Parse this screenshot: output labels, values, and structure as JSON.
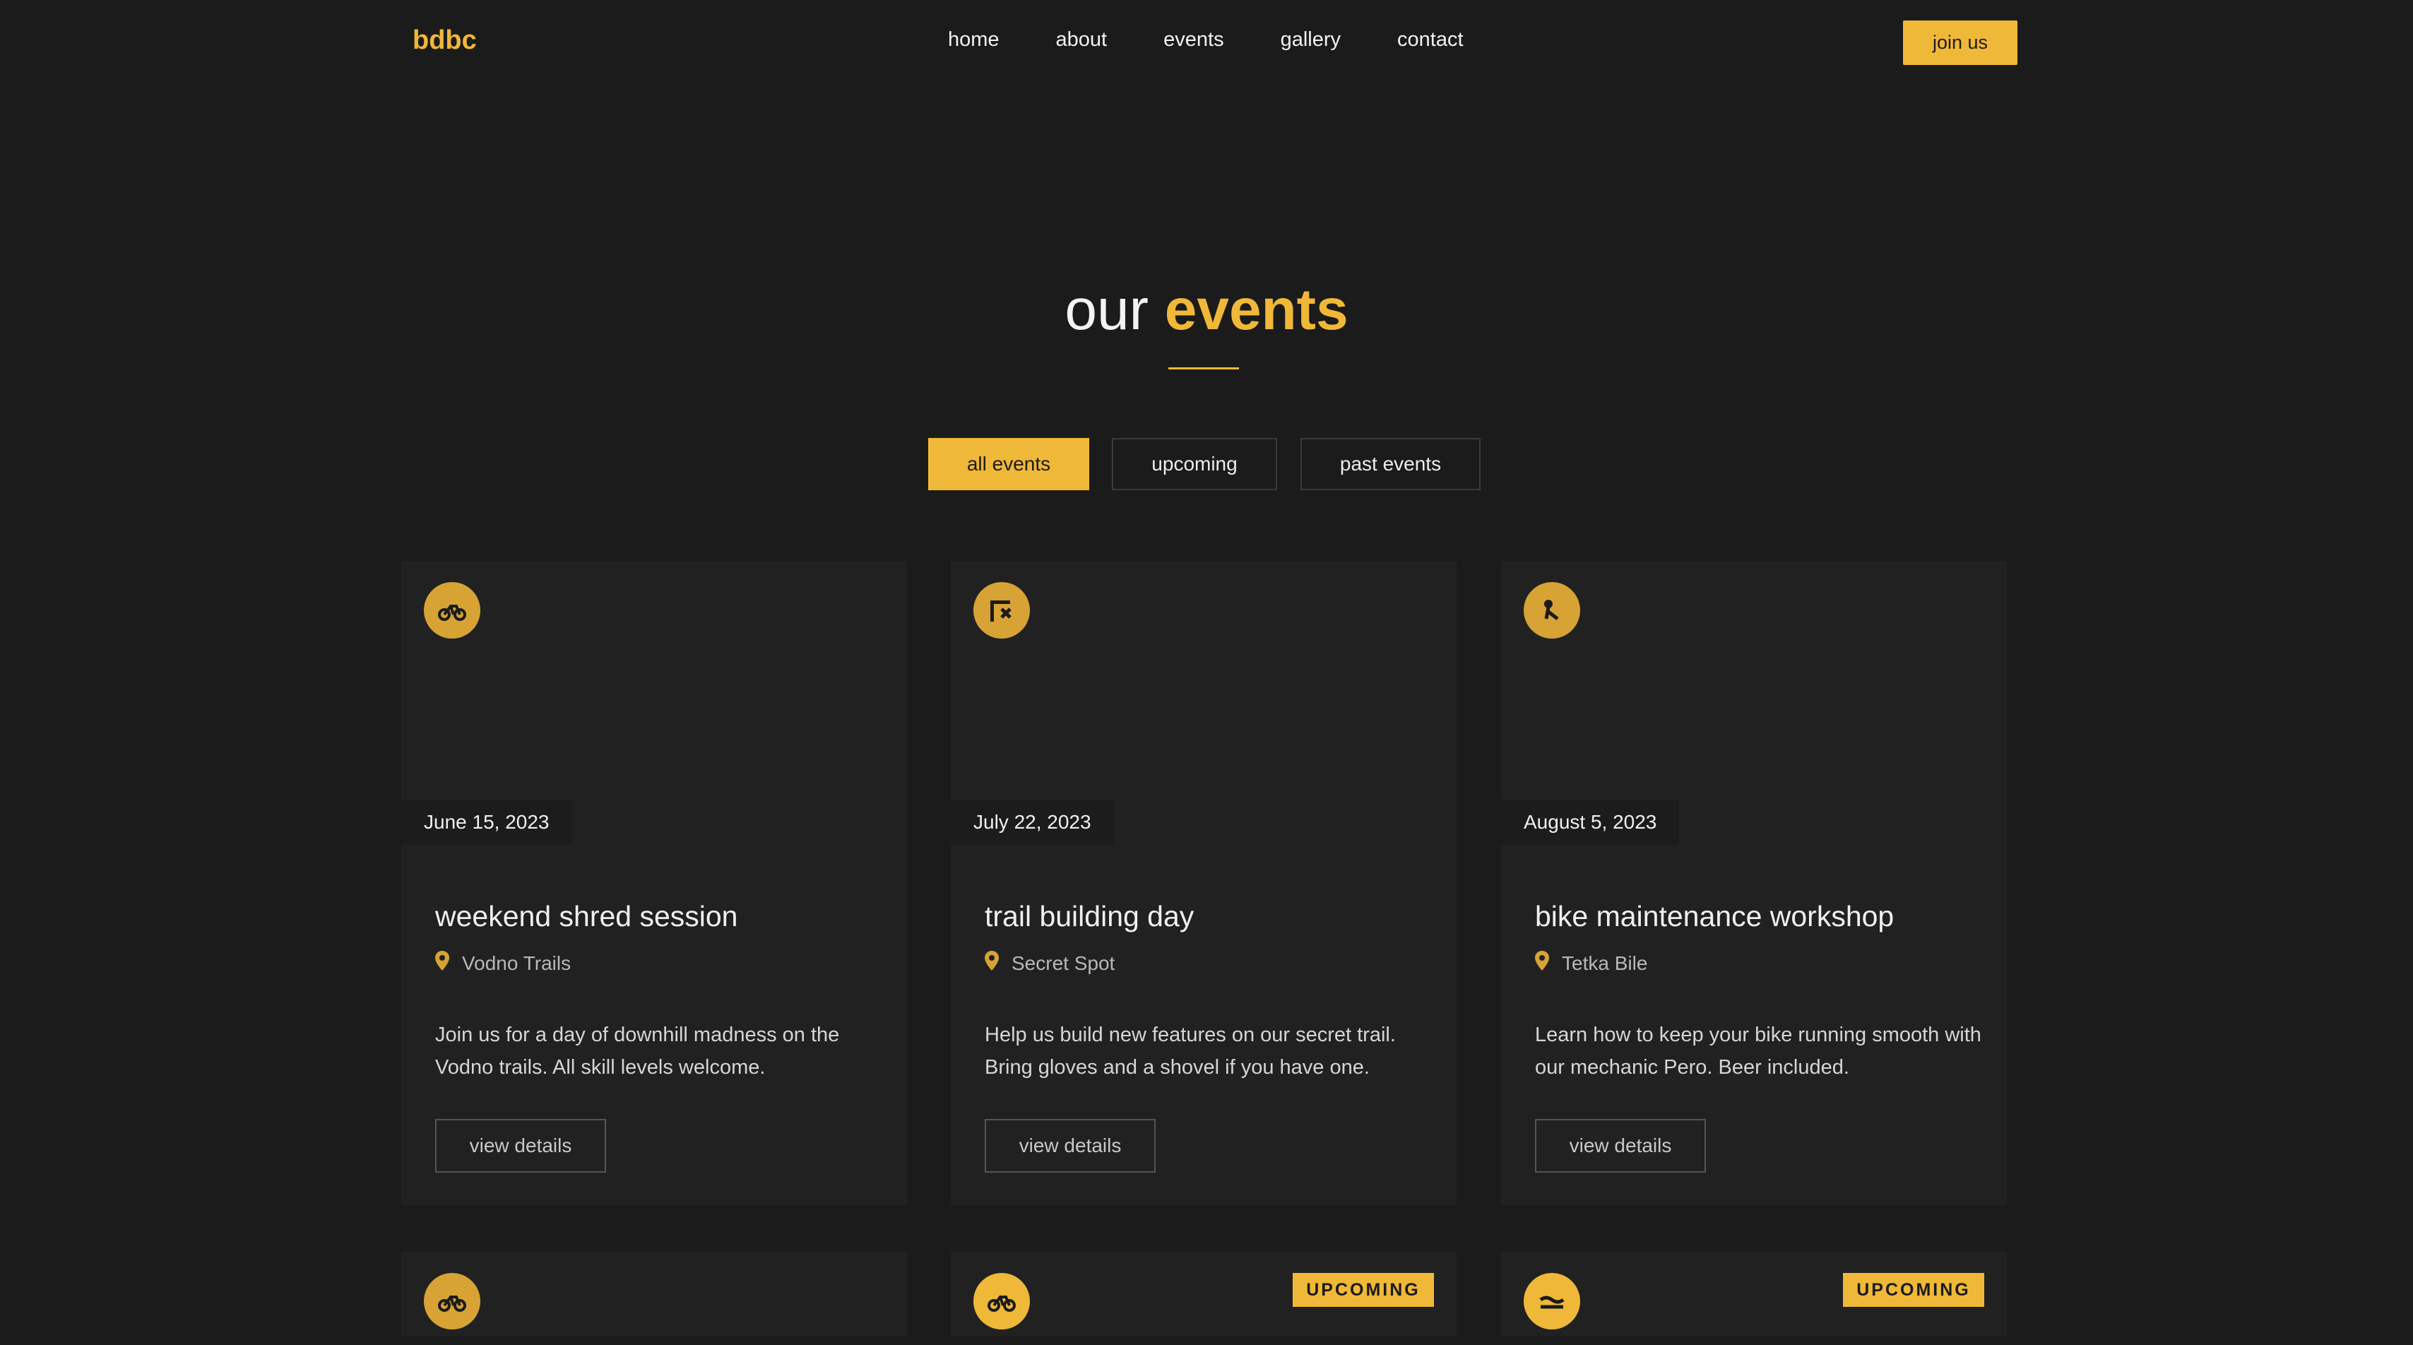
{
  "nav": {
    "logo": "bdbc",
    "links": [
      "home",
      "about",
      "events",
      "gallery",
      "contact"
    ],
    "cta": "join us"
  },
  "header": {
    "title_prefix": "our",
    "title_accent": "events"
  },
  "filters": [
    "all events",
    "upcoming",
    "past events"
  ],
  "active_filter": "all events",
  "events": [
    {
      "icon": "bike-icon",
      "date": "June 15, 2023",
      "title": "weekend shred session",
      "location": "Vodno Trails",
      "description": "Join us for a day of downhill madness on the Vodno trails. All skill levels welcome.",
      "button": "view details"
    },
    {
      "icon": "trail-build-icon",
      "date": "July 22, 2023",
      "title": "trail building day",
      "location": "Secret Spot",
      "description": "Help us build new features on our secret trail. Bring gloves and a shovel if you have one.",
      "button": "view details"
    },
    {
      "icon": "wrench-icon",
      "date": "August 5, 2023",
      "title": "bike maintenance workshop",
      "location": "Tetka Bile",
      "description": "Learn how to keep your bike running smooth with our mechanic Pero. Beer included.",
      "button": "view details"
    },
    {
      "icon": "bike-icon",
      "badge": ""
    },
    {
      "icon": "bike-icon",
      "badge": "UPCOMING"
    },
    {
      "icon": "water-icon",
      "badge": "UPCOMING"
    }
  ],
  "colors": {
    "background": "#1b1b1b",
    "card": "#212121",
    "accent": "#f0b838"
  }
}
